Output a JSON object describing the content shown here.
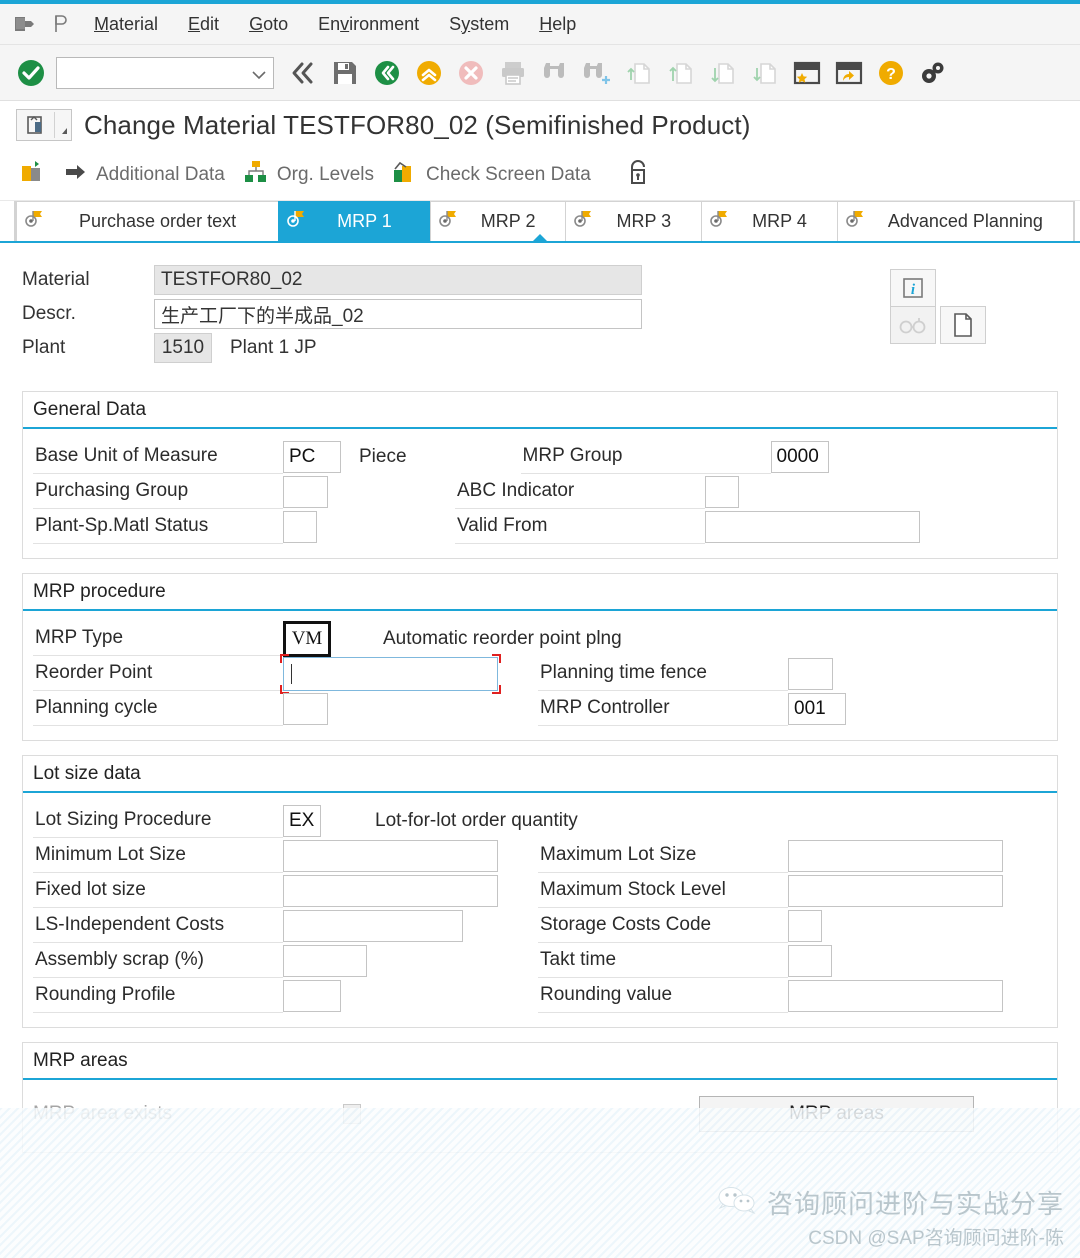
{
  "theme": {
    "accent": "#1ca5d6",
    "menu_bg": "#f5f5f5",
    "readonly_bg": "#e6e6e6",
    "required_border": "#7fb8dd",
    "required_corner": "#e02020",
    "focus_border": "#111111"
  },
  "menubar": {
    "system_icon": "sap-logo-icon",
    "pin_icon": "pin-icon",
    "items": [
      {
        "label": "Material",
        "pre": "",
        "hot": "M",
        "post": "aterial"
      },
      {
        "label": "Edit",
        "pre": "",
        "hot": "E",
        "post": "dit"
      },
      {
        "label": "Goto",
        "pre": "",
        "hot": "G",
        "post": "oto"
      },
      {
        "label": "Environment",
        "pre": "En",
        "hot": "v",
        "post": "ironment"
      },
      {
        "label": "System",
        "pre": "S",
        "hot": "y",
        "post": "stem"
      },
      {
        "label": "Help",
        "pre": "H",
        "hot": "e",
        "post": "lp"
      }
    ]
  },
  "toolbar": {
    "enter_icon": "enter-check-icon",
    "command_field": {
      "value": "",
      "placeholder": ""
    },
    "dropdown_icon": "chevron-down-icon",
    "buttons": [
      {
        "name": "back-double-icon",
        "title": "Back"
      },
      {
        "name": "save-icon",
        "title": "Save"
      },
      {
        "name": "back-green-icon",
        "title": "Back"
      },
      {
        "name": "exit-yellow-icon",
        "title": "Exit"
      },
      {
        "name": "cancel-red-icon",
        "title": "Cancel"
      },
      {
        "name": "print-icon",
        "title": "Print"
      },
      {
        "name": "find-icon",
        "title": "Find"
      },
      {
        "name": "find-next-icon",
        "title": "Find Next"
      },
      {
        "name": "first-page-icon",
        "title": "First Page"
      },
      {
        "name": "previous-page-icon",
        "title": "Previous Page"
      },
      {
        "name": "next-page-icon",
        "title": "Next Page"
      },
      {
        "name": "last-page-icon",
        "title": "Last Page"
      },
      {
        "name": "create-favorite-icon",
        "title": "Create Favorite"
      },
      {
        "name": "create-shortcut-icon",
        "title": "Create Shortcut"
      },
      {
        "name": "help-icon",
        "title": "Help"
      },
      {
        "name": "customize-local-layout-icon",
        "title": "Customize Local Layout"
      }
    ]
  },
  "title": {
    "icon": "material-change-icon",
    "text": "Change Material TESTFOR80_02 (Semifinished Product)"
  },
  "apptoolbar": {
    "items": [
      {
        "label": "",
        "icon": "select-views-icon",
        "has_label": false
      },
      {
        "label": "Additional Data",
        "icon": "arrow-right-icon",
        "has_label": true
      },
      {
        "label": "Org. Levels",
        "icon": "org-levels-icon",
        "has_label": true
      },
      {
        "label": "Check Screen Data",
        "icon": "check-screen-data-icon",
        "has_label": true
      },
      {
        "label": "",
        "icon": "lock-icon",
        "has_label": false
      }
    ]
  },
  "tabs": {
    "items": [
      {
        "label": "Purchase order text",
        "active": false
      },
      {
        "label": "MRP 1",
        "active": true
      },
      {
        "label": "MRP 2",
        "active": false
      },
      {
        "label": "MRP 3",
        "active": false
      },
      {
        "label": "MRP 4",
        "active": false
      },
      {
        "label": "Advanced Planning",
        "active": false
      }
    ],
    "nav": {
      "prev_icon": "chevron-left-icon",
      "next_icon": "chevron-right-icon",
      "list_icon": "tab-list-icon"
    }
  },
  "header": {
    "material": {
      "label": "Material",
      "value": "TESTFOR80_02",
      "readonly": true
    },
    "descr": {
      "label": "Descr.",
      "value": "生产工厂下的半成品_02",
      "readonly": false
    },
    "plant": {
      "label": "Plant",
      "value": "1510",
      "readonly": true,
      "text": "Plant 1 JP"
    },
    "icons": [
      {
        "name": "info-icon",
        "glyph": "i"
      },
      {
        "name": "glasses-icon",
        "glyph": "60"
      },
      {
        "name": "document-icon",
        "glyph": "doc"
      }
    ]
  },
  "sections": {
    "general_data": {
      "title": "General Data",
      "rows": [
        {
          "left": {
            "label": "Base Unit of Measure",
            "value": "PC",
            "size": "code",
            "side": "Piece"
          },
          "right": {
            "label": "MRP Group",
            "value": "0000",
            "size": "code"
          }
        },
        {
          "left": {
            "label": "Purchasing Group",
            "value": "",
            "size": "small"
          },
          "right": {
            "label": "ABC Indicator",
            "value": "",
            "size": "xs"
          }
        },
        {
          "left": {
            "label": "Plant-Sp.Matl Status",
            "value": "",
            "size": "xs"
          },
          "right": {
            "label": "Valid From",
            "value": "",
            "size": "wide"
          }
        }
      ]
    },
    "mrp_procedure": {
      "title": "MRP procedure",
      "rows": [
        {
          "left": {
            "label": "MRP Type",
            "value": "VM",
            "size": "focusblack",
            "side": "Automatic reorder point plng"
          },
          "right": null
        },
        {
          "left": {
            "label": "Reorder Point",
            "value": "",
            "size": "required"
          },
          "right": {
            "label": "Planning time fence",
            "value": "",
            "size": "small"
          }
        },
        {
          "left": {
            "label": "Planning cycle",
            "value": "",
            "size": "small"
          },
          "right": {
            "label": "MRP Controller",
            "value": "001",
            "size": "code"
          }
        }
      ]
    },
    "lot_size_data": {
      "title": "Lot size data",
      "rows": [
        {
          "left": {
            "label": "Lot Sizing Procedure",
            "value": "EX",
            "size": "xsmall",
            "side": "Lot-for-lot order quantity"
          },
          "right": null
        },
        {
          "left": {
            "label": "Minimum Lot Size",
            "value": "",
            "size": "med"
          },
          "right": {
            "label": "Maximum Lot Size",
            "value": "",
            "size": "med"
          }
        },
        {
          "left": {
            "label": "Fixed lot size",
            "value": "",
            "size": "med"
          },
          "right": {
            "label": "Maximum Stock Level",
            "value": "",
            "size": "med"
          }
        },
        {
          "left": {
            "label": "LS-Independent Costs",
            "value": "",
            "size": "med2"
          },
          "right": {
            "label": "Storage Costs Code",
            "value": "",
            "size": "xs"
          }
        },
        {
          "left": {
            "label": "Assembly scrap (%)",
            "value": "",
            "size": "small2"
          },
          "right": {
            "label": "Takt time",
            "value": "",
            "size": "small2"
          }
        },
        {
          "left": {
            "label": "Rounding Profile",
            "value": "",
            "size": "small"
          },
          "right": {
            "label": "Rounding value",
            "value": "",
            "size": "med"
          }
        }
      ]
    },
    "mrp_areas": {
      "title": "MRP areas",
      "checkbox_label": "MRP area exists",
      "checkbox_checked": false,
      "checkbox_disabled": true,
      "button_label": "MRP areas"
    }
  },
  "watermark": {
    "icon": "wechat-icon",
    "line1": "咨询顾问进阶与实战分享",
    "line2": "CSDN @SAP咨询顾问进阶-陈"
  }
}
